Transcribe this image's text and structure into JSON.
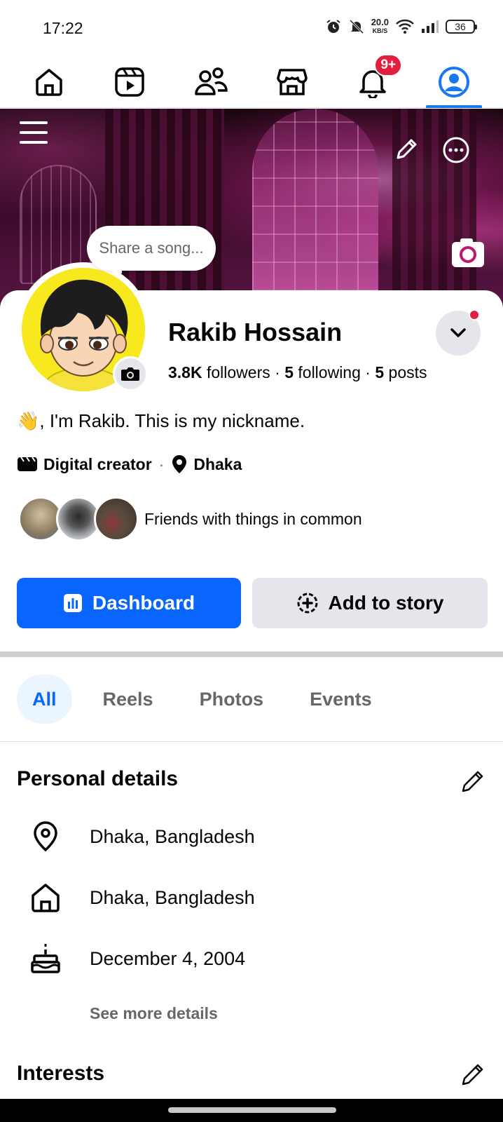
{
  "status_bar": {
    "time": "17:22",
    "net_speed_value": "20.0",
    "net_speed_unit": "KB/S",
    "battery": "36"
  },
  "nav": {
    "notification_badge": "9+",
    "accent": "#1877f2",
    "items": [
      "home-icon",
      "reels-icon",
      "friends-icon",
      "marketplace-icon",
      "notifications-icon",
      "profile-icon"
    ]
  },
  "cover": {
    "song_prompt": "Share a song..."
  },
  "profile": {
    "name": "Rakib Hossain",
    "followers_count": "3.8K",
    "followers_label": "followers",
    "following_count": "5",
    "following_label": "following",
    "posts_count": "5",
    "posts_label": "posts",
    "bio": "👋, I'm Rakib. This is my nickname.",
    "category": "Digital creator",
    "location": "Dhaka",
    "friends_text": "Friends with things in common"
  },
  "actions": {
    "dashboard_label": "Dashboard",
    "add_story_label": "Add to story",
    "primary_color": "#0866ff"
  },
  "tabs": [
    {
      "label": "All",
      "active": true
    },
    {
      "label": "Reels",
      "active": false
    },
    {
      "label": "Photos",
      "active": false
    },
    {
      "label": "Events",
      "active": false
    }
  ],
  "personal_details": {
    "title": "Personal details",
    "rows": [
      {
        "icon": "location-pin-icon",
        "text": "Dhaka, Bangladesh"
      },
      {
        "icon": "house-icon",
        "text": "Dhaka, Bangladesh"
      },
      {
        "icon": "birthday-cake-icon",
        "text": "December 4, 2004"
      }
    ],
    "see_more": "See more details"
  },
  "interests": {
    "title": "Interests"
  }
}
